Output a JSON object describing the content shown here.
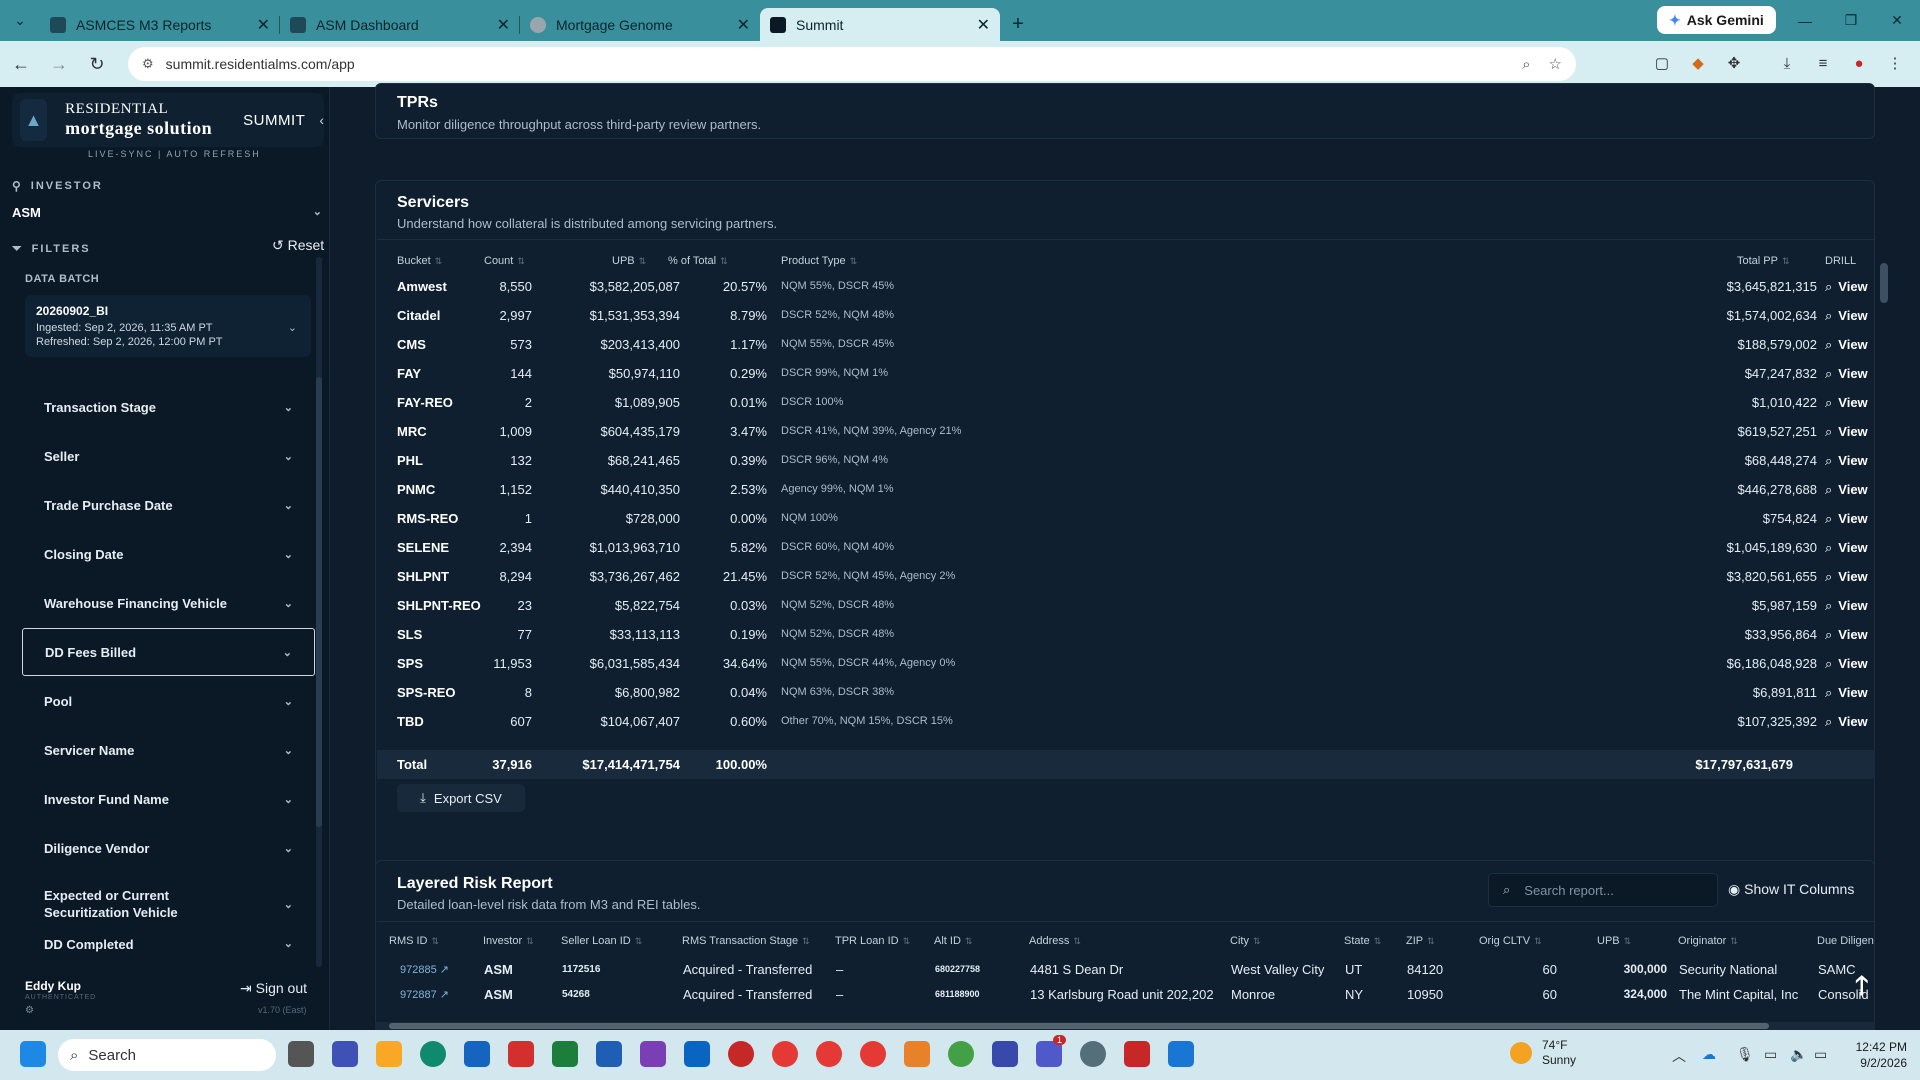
{
  "browser": {
    "tabs": [
      {
        "title": "ASMCES M3 Reports"
      },
      {
        "title": "ASM Dashboard"
      },
      {
        "title": "Mortgage Genome"
      },
      {
        "title": "Summit"
      }
    ],
    "ask_gemini": "Ask Gemini",
    "url": "summit.residentialms.com/app"
  },
  "sidebar": {
    "brand": "RESIDENTIAL",
    "brand_main": "mortgage solution",
    "product": "SUMMIT",
    "livesync": "LIVE-SYNC | AUTO REFRESH",
    "investor_label": "INVESTOR",
    "investor_value": "ASM",
    "filters_label": "FILTERS",
    "reset_label": "Reset",
    "data_batch_label": "DATA BATCH",
    "batch": {
      "name": "20260902_BI",
      "ingested": "Ingested: Sep 2, 2026, 11:35 AM PT",
      "refreshed": "Refreshed: Sep 2, 2026, 12:00 PM PT"
    },
    "filters": [
      "Transaction Stage",
      "Seller",
      "Trade Purchase Date",
      "Closing Date",
      "Warehouse Financing Vehicle",
      "DD Fees Billed",
      "Pool",
      "Servicer Name",
      "Investor Fund Name",
      "Diligence Vendor",
      "Expected or Current Securitization Vehicle",
      "DD Completed"
    ],
    "user": "Eddy Kup",
    "user_status": "AUTHENTICATED",
    "sign_out": "Sign out",
    "version": "v1.70 (East)"
  },
  "tprs": {
    "title": "TPRs",
    "subtitle": "Monitor diligence throughput across third-party review partners."
  },
  "servicers": {
    "title": "Servicers",
    "subtitle": "Understand how collateral is distributed among servicing partners.",
    "headers": {
      "bucket": "Bucket",
      "count": "Count",
      "upb": "UPB",
      "pct": "% of Total",
      "product": "Product Type",
      "total_pp": "Total PP",
      "drill": "DRILL"
    },
    "view_label": "View",
    "rows": [
      {
        "bucket": "Amwest",
        "count": "8,550",
        "upb": "$3,582,205,087",
        "pct": "20.57%",
        "product": "NQM 55%, DSCR 45%",
        "pp": "$3,645,821,315"
      },
      {
        "bucket": "Citadel",
        "count": "2,997",
        "upb": "$1,531,353,394",
        "pct": "8.79%",
        "product": "DSCR 52%, NQM 48%",
        "pp": "$1,574,002,634"
      },
      {
        "bucket": "CMS",
        "count": "573",
        "upb": "$203,413,400",
        "pct": "1.17%",
        "product": "NQM 55%, DSCR 45%",
        "pp": "$188,579,002"
      },
      {
        "bucket": "FAY",
        "count": "144",
        "upb": "$50,974,110",
        "pct": "0.29%",
        "product": "DSCR 99%, NQM 1%",
        "pp": "$47,247,832"
      },
      {
        "bucket": "FAY-REO",
        "count": "2",
        "upb": "$1,089,905",
        "pct": "0.01%",
        "product": "DSCR 100%",
        "pp": "$1,010,422"
      },
      {
        "bucket": "MRC",
        "count": "1,009",
        "upb": "$604,435,179",
        "pct": "3.47%",
        "product": "DSCR 41%, NQM 39%, Agency 21%",
        "pp": "$619,527,251"
      },
      {
        "bucket": "PHL",
        "count": "132",
        "upb": "$68,241,465",
        "pct": "0.39%",
        "product": "DSCR 96%, NQM 4%",
        "pp": "$68,448,274"
      },
      {
        "bucket": "PNMC",
        "count": "1,152",
        "upb": "$440,410,350",
        "pct": "2.53%",
        "product": "Agency 99%, NQM 1%",
        "pp": "$446,278,688"
      },
      {
        "bucket": "RMS-REO",
        "count": "1",
        "upb": "$728,000",
        "pct": "0.00%",
        "product": "NQM 100%",
        "pp": "$754,824"
      },
      {
        "bucket": "SELENE",
        "count": "2,394",
        "upb": "$1,013,963,710",
        "pct": "5.82%",
        "product": "DSCR 60%, NQM 40%",
        "pp": "$1,045,189,630"
      },
      {
        "bucket": "SHLPNT",
        "count": "8,294",
        "upb": "$3,736,267,462",
        "pct": "21.45%",
        "product": "DSCR 52%, NQM 45%, Agency 2%",
        "pp": "$3,820,561,655"
      },
      {
        "bucket": "SHLPNT-REO",
        "count": "23",
        "upb": "$5,822,754",
        "pct": "0.03%",
        "product": "NQM 52%, DSCR 48%",
        "pp": "$5,987,159"
      },
      {
        "bucket": "SLS",
        "count": "77",
        "upb": "$33,113,113",
        "pct": "0.19%",
        "product": "NQM 52%, DSCR 48%",
        "pp": "$33,956,864"
      },
      {
        "bucket": "SPS",
        "count": "11,953",
        "upb": "$6,031,585,434",
        "pct": "34.64%",
        "product": "NQM 55%, DSCR 44%, Agency 0%",
        "pp": "$6,186,048,928"
      },
      {
        "bucket": "SPS-REO",
        "count": "8",
        "upb": "$6,800,982",
        "pct": "0.04%",
        "product": "NQM 63%, DSCR 38%",
        "pp": "$6,891,811"
      },
      {
        "bucket": "TBD",
        "count": "607",
        "upb": "$104,067,407",
        "pct": "0.60%",
        "product": "Other 70%, NQM 15%, DSCR 15%",
        "pp": "$107,325,392"
      }
    ],
    "total": {
      "label": "Total",
      "count": "37,916",
      "upb": "$17,414,471,754",
      "pct": "100.00%",
      "pp": "$17,797,631,679"
    },
    "export_label": "Export CSV"
  },
  "layered": {
    "title": "Layered Risk Report",
    "subtitle": "Detailed loan-level risk data from M3 and REI tables.",
    "search_placeholder": "Search report...",
    "show_it_label": "Show IT Columns",
    "headers": [
      "RMS ID",
      "Investor",
      "Seller Loan ID",
      "RMS Transaction Stage",
      "TPR Loan ID",
      "Alt ID",
      "Address",
      "City",
      "State",
      "ZIP",
      "Orig CLTV",
      "UPB",
      "Originator",
      "Due Diligen"
    ],
    "rows": [
      {
        "rms_id": "972885",
        "investor": "ASM",
        "seller_loan_id": "1172516",
        "stage": "Acquired - Transferred",
        "tpr": "–",
        "alt_id": "680227758",
        "address": "4481 S Dean Dr",
        "city": "West Valley City",
        "state": "UT",
        "zip": "84120",
        "cltv": "60",
        "upb": "300,000",
        "originator": "Security National",
        "dd": "SAMC"
      },
      {
        "rms_id": "972887",
        "investor": "ASM",
        "seller_loan_id": "54268",
        "stage": "Acquired - Transferred",
        "tpr": "–",
        "alt_id": "681188900",
        "address": "13 Karlsburg Road unit 202,202",
        "city": "Monroe",
        "state": "NY",
        "zip": "10950",
        "cltv": "60",
        "upb": "324,000",
        "originator": "The Mint Capital, Inc",
        "dd": "Consolid"
      }
    ]
  },
  "taskbar": {
    "search": "Search",
    "temp": "74°F",
    "weather": "Sunny",
    "time": "12:42 PM",
    "date": "9/2/2026",
    "badge": "1"
  }
}
